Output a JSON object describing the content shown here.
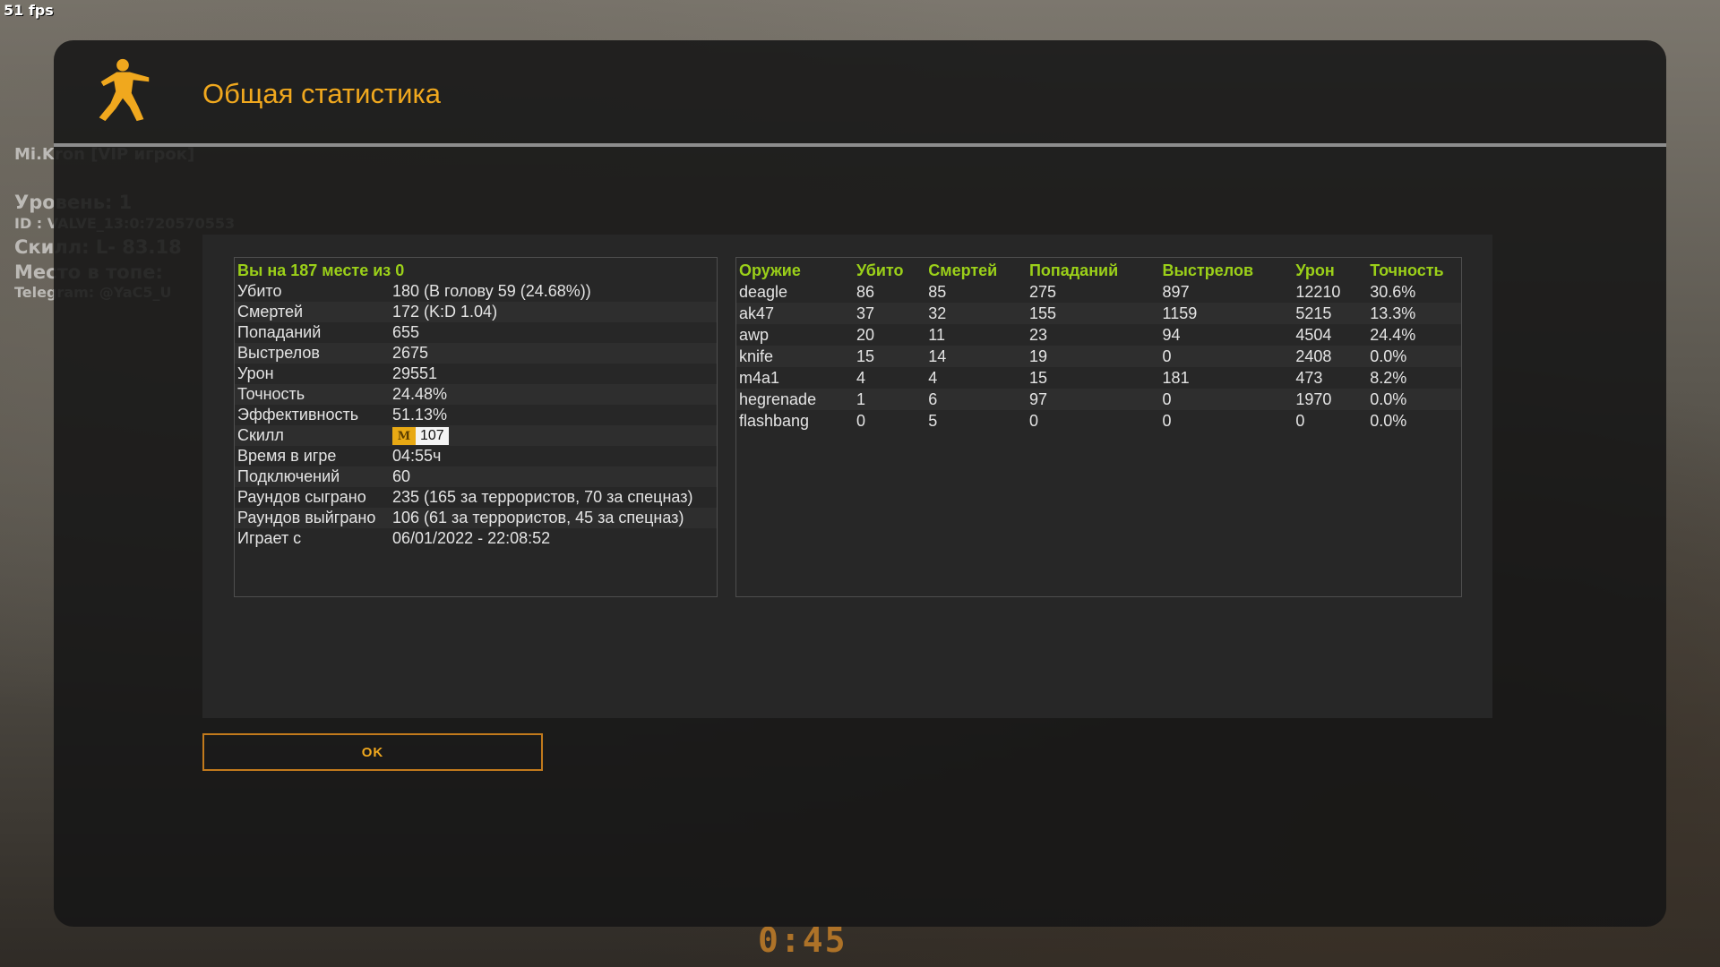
{
  "hud": {
    "fps": "51 fps",
    "background_text": [
      "Mi.Kron [VIP игрок]",
      "Уровень: 1",
      "ID : VALVE_13:0:720570553",
      "Скилл: L- 83.18",
      "Место в топе:",
      "Telegram: @YaC5_U"
    ],
    "round_timer": "0:45"
  },
  "dialog": {
    "title": "Общая статистика",
    "logo_icon": "counter-strike-logo-icon",
    "accent_color": "#f0a81e",
    "ok_label": "OK"
  },
  "stats": {
    "header": "Вы на 187 месте из 0",
    "rows": [
      {
        "label": "Убито",
        "value": "180 (В голову 59 (24.68%))"
      },
      {
        "label": "Смертей",
        "value": "172 (K:D 1.04)"
      },
      {
        "label": "Попаданий",
        "value": "655"
      },
      {
        "label": "Выстрелов",
        "value": "2675"
      },
      {
        "label": "Урон",
        "value": "29551"
      },
      {
        "label": "Точность",
        "value": "24.48%"
      },
      {
        "label": "Эффективность",
        "value": "51.13%"
      }
    ],
    "skill": {
      "label": "Скилл",
      "letter": "M",
      "value": "107",
      "badge_color": "#e8a914"
    },
    "rows2": [
      {
        "label": "Время в игре",
        "value": "04:55ч"
      },
      {
        "label": "Подключений",
        "value": "60"
      },
      {
        "label": "Раундов сыграно",
        "value": "235 (165 за террористов, 70 за спецназ)"
      },
      {
        "label": "Раундов выйграно",
        "value": "106 (61 за террористов, 45 за спецназ)"
      },
      {
        "label": "Играет с",
        "value": "06/01/2022 - 22:08:52"
      }
    ]
  },
  "weapons": {
    "columns": [
      "Оружие",
      "Убито",
      "Смертей",
      "Попаданий",
      "Выстрелов",
      "Урон",
      "Точность"
    ],
    "rows": [
      [
        "deagle",
        "86",
        "85",
        "275",
        "897",
        "12210",
        "30.6%"
      ],
      [
        "ak47",
        "37",
        "32",
        "155",
        "1159",
        "5215",
        "13.3%"
      ],
      [
        "awp",
        "20",
        "11",
        "23",
        "94",
        "4504",
        "24.4%"
      ],
      [
        "knife",
        "15",
        "14",
        "19",
        "0",
        "2408",
        "0.0%"
      ],
      [
        "m4a1",
        "4",
        "4",
        "15",
        "181",
        "473",
        "8.2%"
      ],
      [
        "hegrenade",
        "1",
        "6",
        "97",
        "0",
        "1970",
        "0.0%"
      ],
      [
        "flashbang",
        "0",
        "5",
        "0",
        "0",
        "0",
        "0.0%"
      ]
    ]
  }
}
